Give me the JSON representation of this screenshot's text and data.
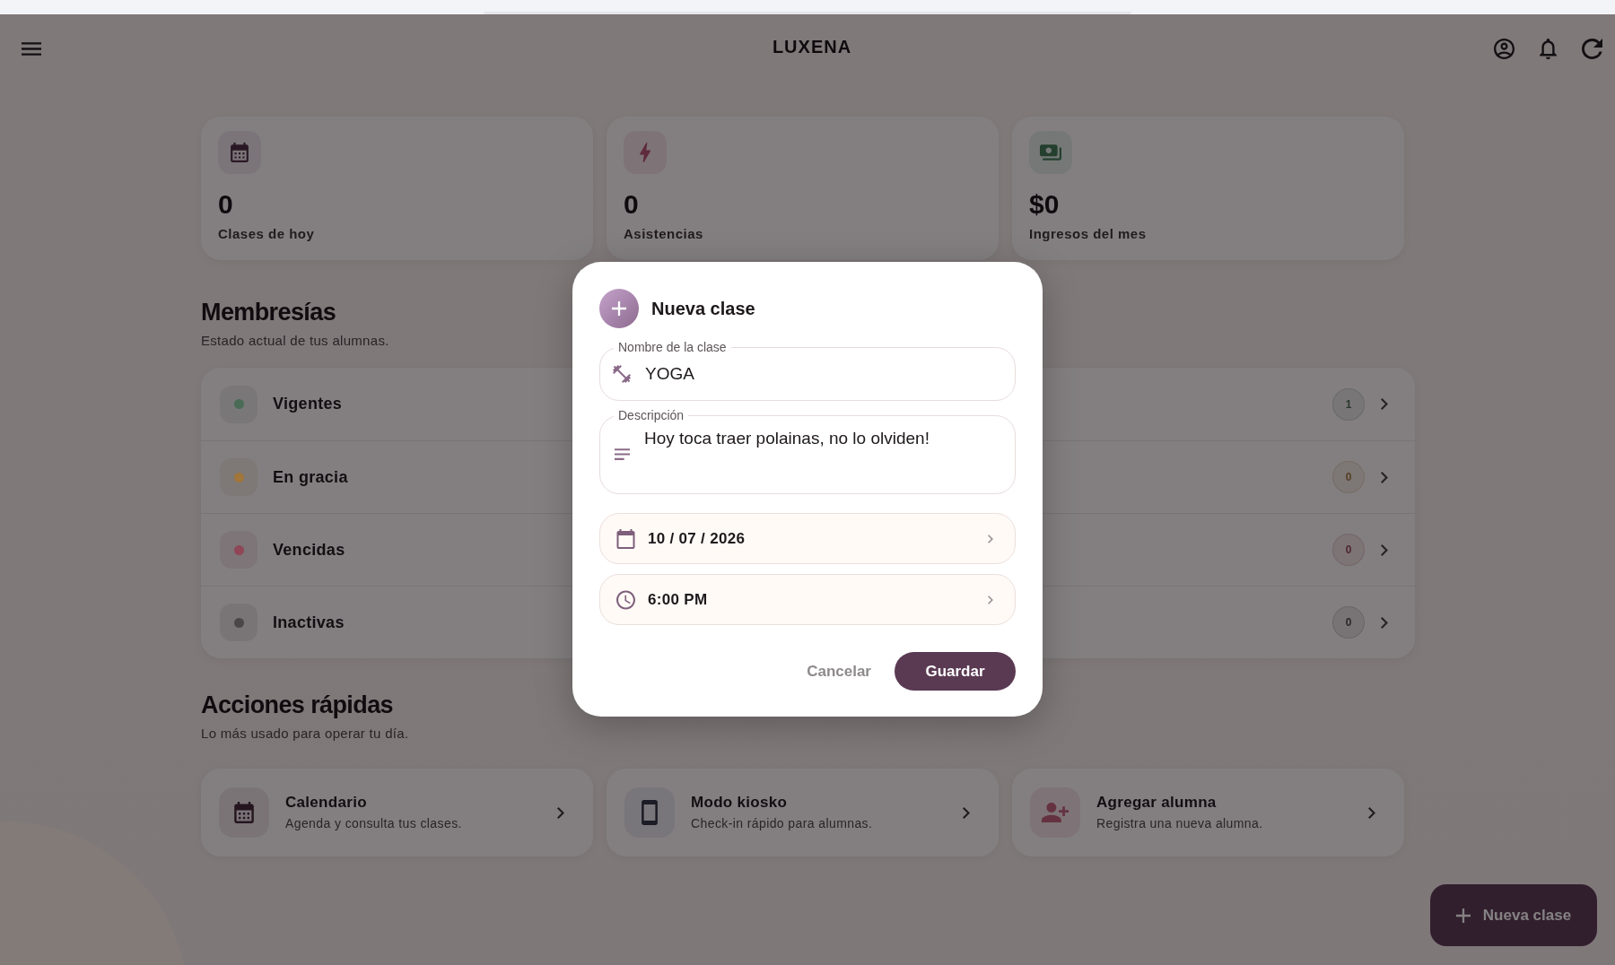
{
  "header": {
    "title": "LUXENA"
  },
  "metrics": [
    {
      "kind": "classes",
      "value": "0",
      "label": "Clases de hoy"
    },
    {
      "kind": "attendance",
      "value": "0",
      "label": "Asistencias"
    },
    {
      "kind": "income",
      "value": "$0",
      "label": "Ingresos del mes"
    }
  ],
  "memberships": {
    "title": "Membresías",
    "subtitle": "Estado actual de tus alumnas.",
    "items": [
      {
        "label": "Vigentes",
        "count": "1",
        "color": "#4a6b55"
      },
      {
        "label": "En gracia",
        "count": "0",
        "color": "#a0763a"
      },
      {
        "label": "Vencidas",
        "count": "0",
        "color": "#904656"
      },
      {
        "label": "Inactivas",
        "count": "0",
        "color": "#4b4647"
      }
    ]
  },
  "quick_actions": {
    "title": "Acciones rápidas",
    "subtitle": "Lo más usado para operar tu día.",
    "items": [
      {
        "kind": "calendar",
        "title": "Calendario",
        "description": "Agenda y consulta tus clases."
      },
      {
        "kind": "kiosk",
        "title": "Modo kiosko",
        "description": "Check-in rápido para alumnas."
      },
      {
        "kind": "add_student",
        "title": "Agregar alumna",
        "description": "Registra una nueva alumna."
      }
    ]
  },
  "fab": {
    "label": "Nueva clase"
  },
  "dialog": {
    "title": "Nueva clase",
    "fields": [
      {
        "kind": "text",
        "label": "Nombre de la clase",
        "value": "YOGA"
      },
      {
        "kind": "multiline",
        "label": "Descripción",
        "value": "Hoy toca traer polainas, no lo olviden!"
      }
    ],
    "pickers": [
      {
        "kind": "date",
        "value": "10 / 07 / 2026"
      },
      {
        "kind": "time",
        "value": "6:00 PM"
      }
    ],
    "buttons": [
      {
        "kind": "text",
        "label": "Cancelar"
      },
      {
        "kind": "primary",
        "label": "Guardar"
      }
    ]
  }
}
